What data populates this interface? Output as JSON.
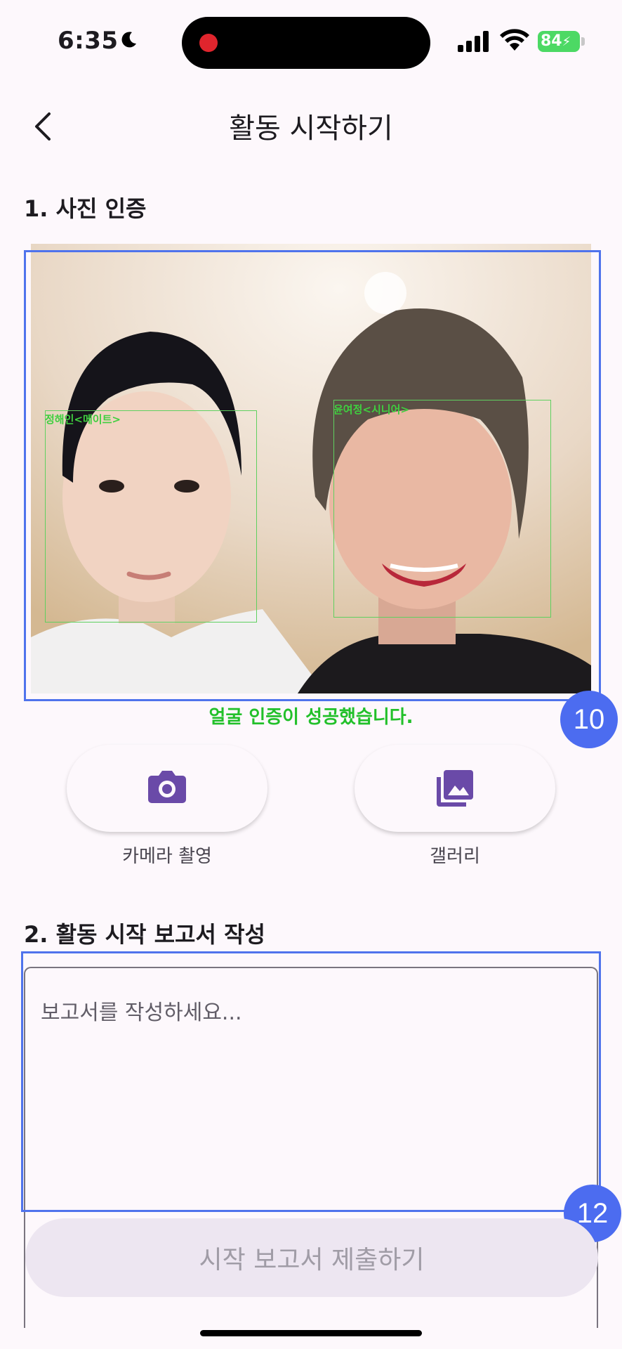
{
  "status_bar": {
    "time": "6:35",
    "battery": "84"
  },
  "header": {
    "title": "활동 시작하기"
  },
  "section1": {
    "title": "1. 사진 인증"
  },
  "photo": {
    "faces": [
      {
        "label": "정해인<메이트>"
      },
      {
        "label": "윤여정<시니어>"
      }
    ],
    "badge": "10"
  },
  "verification": {
    "message": "얼굴 인증이 성공했습니다."
  },
  "actions": {
    "camera_label": "카메라 촬영",
    "gallery_label": "갤러리"
  },
  "section2": {
    "title": "2. 활동 시작 보고서 작성"
  },
  "report": {
    "placeholder": "보고서를 작성하세요...",
    "value": "",
    "badge": "12"
  },
  "submit": {
    "label": "시작 보고서 제출하기"
  },
  "colors": {
    "accent": "#6a4aa8",
    "success": "#22c02a",
    "marker": "#4c6cf0"
  }
}
